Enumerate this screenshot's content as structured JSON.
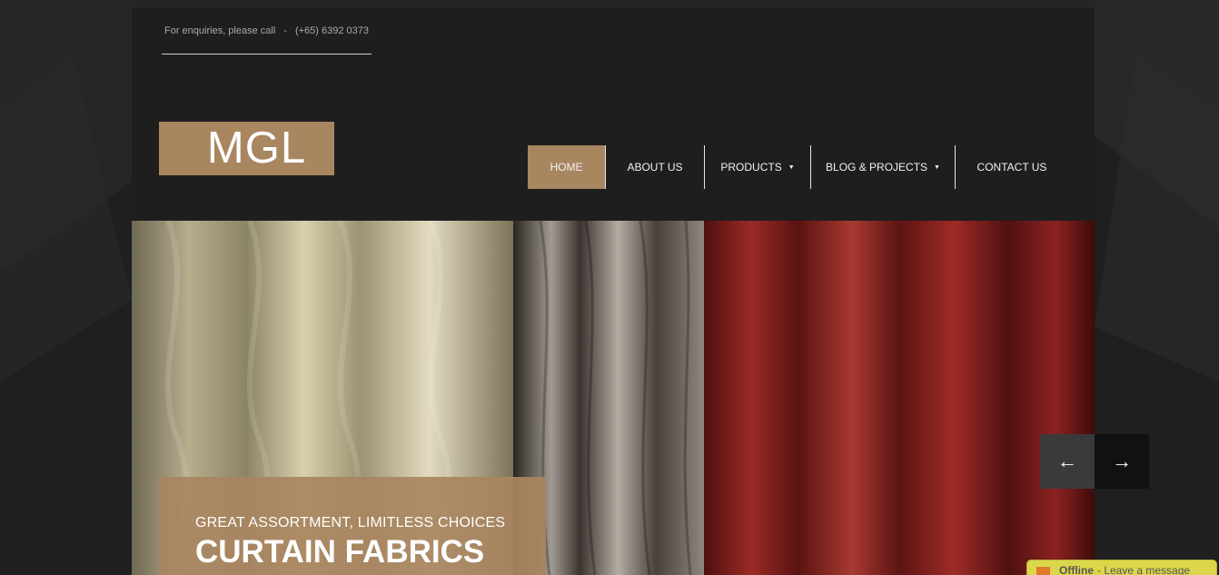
{
  "topbar": {
    "enquiry_label": "For enquiries, please call",
    "separator": "-",
    "phone": "(+65) 6392 0373"
  },
  "logo": {
    "text": "MGL"
  },
  "nav": {
    "items": [
      {
        "label": "HOME",
        "active": true,
        "dropdown": false
      },
      {
        "label": "ABOUT US",
        "active": false,
        "dropdown": false
      },
      {
        "label": "PRODUCTS",
        "active": false,
        "dropdown": true
      },
      {
        "label": "BLOG & PROJECTS",
        "active": false,
        "dropdown": true
      },
      {
        "label": "CONTACT US",
        "active": false,
        "dropdown": false
      }
    ]
  },
  "slider": {
    "subtitle": "GREAT ASSORTMENT, LIMITLESS CHOICES",
    "title": "CURTAIN FABRICS",
    "prev_icon": "←",
    "next_icon": "→"
  },
  "chat": {
    "status": "Offline",
    "message": "- Leave a message"
  },
  "colors": {
    "accent": "#a88660",
    "background": "#232323",
    "container": "#1e1e1e",
    "chat": "#dcd64a"
  }
}
